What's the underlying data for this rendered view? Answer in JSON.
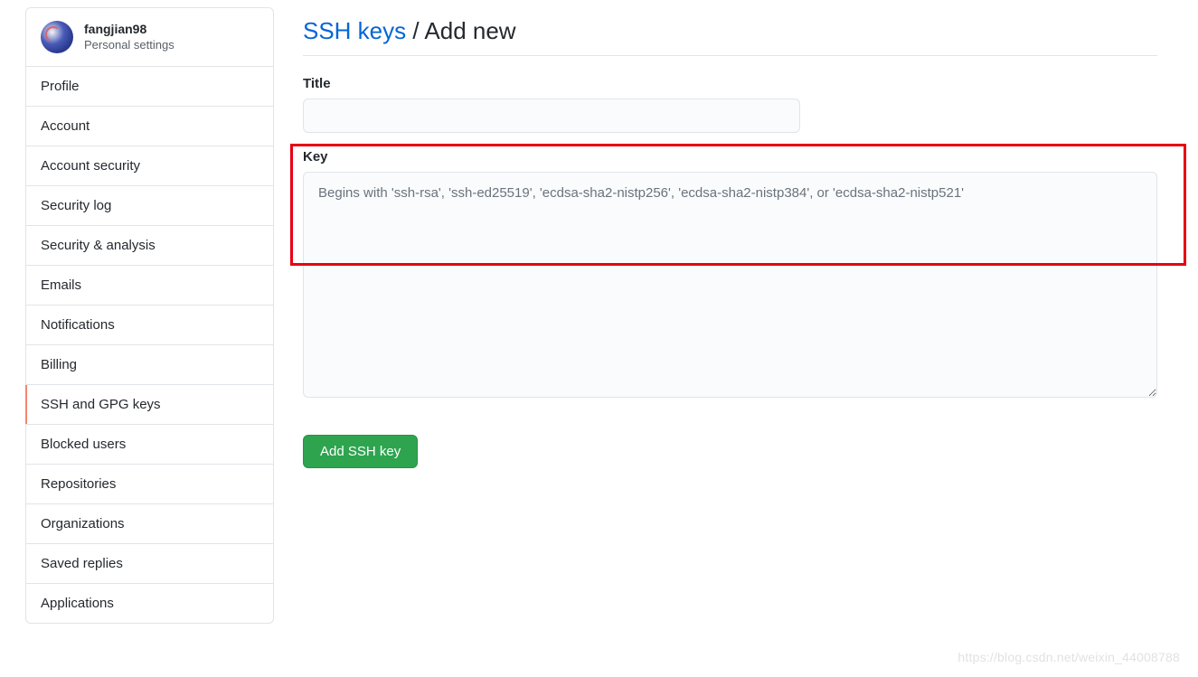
{
  "sidebar": {
    "username": "fangjian98",
    "subtitle": "Personal settings",
    "items": [
      {
        "label": "Profile"
      },
      {
        "label": "Account"
      },
      {
        "label": "Account security"
      },
      {
        "label": "Security log"
      },
      {
        "label": "Security & analysis"
      },
      {
        "label": "Emails"
      },
      {
        "label": "Notifications"
      },
      {
        "label": "Billing"
      },
      {
        "label": "SSH and GPG keys"
      },
      {
        "label": "Blocked users"
      },
      {
        "label": "Repositories"
      },
      {
        "label": "Organizations"
      },
      {
        "label": "Saved replies"
      },
      {
        "label": "Applications"
      }
    ],
    "active_index": 8
  },
  "heading": {
    "link_text": "SSH keys",
    "separator": " / ",
    "current": "Add new"
  },
  "form": {
    "title_label": "Title",
    "title_value": "",
    "key_label": "Key",
    "key_value": "",
    "key_placeholder": "Begins with 'ssh-rsa', 'ssh-ed25519', 'ecdsa-sha2-nistp256', 'ecdsa-sha2-nistp384', or 'ecdsa-sha2-nistp521'",
    "submit_label": "Add SSH key"
  },
  "watermark": "https://blog.csdn.net/weixin_44008788"
}
